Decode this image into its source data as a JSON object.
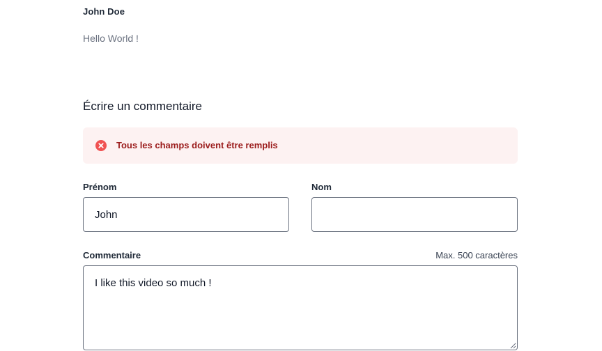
{
  "comment": {
    "author": "John Doe",
    "text": "Hello World !"
  },
  "form": {
    "title": "Écrire un commentaire",
    "alert": {
      "message": "Tous les champs doivent être remplis",
      "icon": "x-circle-icon",
      "color": "#e02424"
    },
    "firstname": {
      "label": "Prénom",
      "value": "John"
    },
    "lastname": {
      "label": "Nom",
      "value": ""
    },
    "comment": {
      "label": "Commentaire",
      "hint": "Max. 500 caractères",
      "value": "I like this video so much !"
    }
  }
}
